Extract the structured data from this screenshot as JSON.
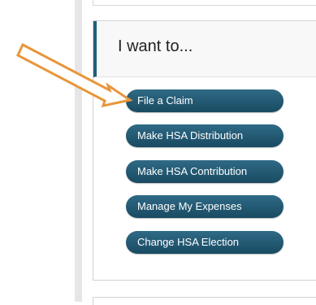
{
  "panel": {
    "title": "I want to..."
  },
  "actions": [
    {
      "label": "File a Claim"
    },
    {
      "label": "Make HSA Distribution"
    },
    {
      "label": "Make HSA Contribution"
    },
    {
      "label": "Manage My Expenses"
    },
    {
      "label": "Change HSA Election"
    }
  ],
  "colors": {
    "button": "#1f5b76",
    "accent_border": "#1f5f7a",
    "arrow_stroke": "#e8963a",
    "arrow_fill": "#ffffff"
  },
  "icons": {
    "annotation": "arrow-annotation-icon"
  }
}
